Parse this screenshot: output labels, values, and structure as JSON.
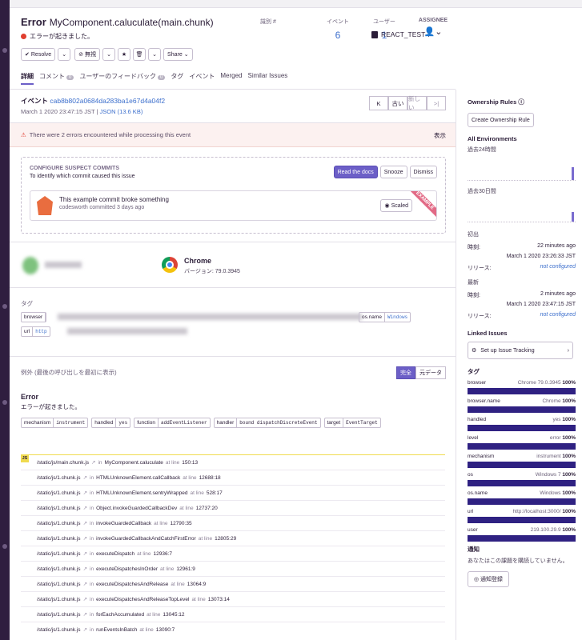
{
  "header": {
    "error_label": "Error",
    "title": "MyComponent.caluculate(main.chunk)",
    "message": "エラーが起きました。",
    "project_label": "識別 #",
    "project_name": "REACT_TEST-7",
    "events_label": "イベント",
    "events_count": "6",
    "users_label": "ユーザー",
    "users_count": "1",
    "assignee_label": "ASSIGNEE",
    "actions": {
      "resolve": "Resolve",
      "ignore": "無視",
      "share": "Share"
    },
    "tabs": [
      {
        "label": "詳細"
      },
      {
        "label": "コメント",
        "badge": "0"
      },
      {
        "label": "ユーザーのフィードバック",
        "badge": "0"
      },
      {
        "label": "タグ"
      },
      {
        "label": "イベント"
      },
      {
        "label": "Merged"
      },
      {
        "label": "Similar Issues"
      }
    ]
  },
  "event": {
    "label": "イベント",
    "id": "cab8b802a0684da283ba1e67d4a04f2",
    "timestamp": "March 1 2020 23:47:15 JST",
    "json_link": "JSON (13.6 KB)",
    "nav_older": "古い",
    "nav_newer": "新しい"
  },
  "alert": {
    "text": "There were 2 errors encountered while processing this event",
    "show": "表示"
  },
  "suspect": {
    "heading": "CONFIGURE SUSPECT COMMITS",
    "subheading": "To identify which commit caused this issue",
    "read_docs": "Read the docs",
    "snooze": "Snooze",
    "dismiss": "Dismiss",
    "commit_title": "This example commit broke something",
    "commit_meta": "codesworth committed 3 days ago",
    "scaled": "Scaled",
    "ribbon": "EXAMPLE"
  },
  "user_agent": {
    "browser": "Chrome",
    "version": "バージョン: 79.0.3945"
  },
  "tags_section": {
    "heading": "タグ",
    "pills": [
      {
        "key": "browser",
        "value": ""
      },
      {
        "key": "os.name",
        "value": "Windows"
      },
      {
        "key": "url",
        "value": "http"
      }
    ]
  },
  "exception": {
    "heading": "例外 (最後の呼び出しを最初に表示)",
    "toggle_full": "完全",
    "toggle_raw": "元データ",
    "type": "Error",
    "message": "エラーが起きました。",
    "mechanism": [
      {
        "key": "mechanism",
        "value": "instrument"
      },
      {
        "key": "handled",
        "value": "yes"
      },
      {
        "key": "function",
        "value": "addEventListener"
      },
      {
        "key": "handler",
        "value": "bound dispatchDiscreteEvent"
      },
      {
        "key": "target",
        "value": "EventTarget"
      }
    ],
    "js_badge": "JS",
    "in_word": "in",
    "at_line_word": "at line",
    "frames": [
      {
        "file": "/static/js/main.chunk.js",
        "fn": "MyComponent.caluculate",
        "line": "150:13"
      },
      {
        "file": "/static/js/1.chunk.js",
        "fn": "HTMLUnknownElement.callCallback",
        "line": "12688:18"
      },
      {
        "file": "/static/js/1.chunk.js",
        "fn": "HTMLUnknownElement.sentryWrapped",
        "line": "528:17"
      },
      {
        "file": "/static/js/1.chunk.js",
        "fn": "Object.invokeGuardedCallbackDev",
        "line": "12737:20"
      },
      {
        "file": "/static/js/1.chunk.js",
        "fn": "invokeGuardedCallback",
        "line": "12790:35"
      },
      {
        "file": "/static/js/1.chunk.js",
        "fn": "invokeGuardedCallbackAndCatchFirstError",
        "line": "12805:29"
      },
      {
        "file": "/static/js/1.chunk.js",
        "fn": "executeDispatch",
        "line": "12936:7"
      },
      {
        "file": "/static/js/1.chunk.js",
        "fn": "executeDispatchesInOrder",
        "line": "12961:9"
      },
      {
        "file": "/static/js/1.chunk.js",
        "fn": "executeDispatchesAndRelease",
        "line": "13064:9"
      },
      {
        "file": "/static/js/1.chunk.js",
        "fn": "executeDispatchesAndReleaseTopLevel",
        "line": "13073:14"
      },
      {
        "file": "/static/js/1.chunk.js",
        "fn": "forEachAccumulated",
        "line": "13045:12"
      },
      {
        "file": "/static/js/1.chunk.js",
        "fn": "runEventsInBatch",
        "line": "13090:7"
      }
    ]
  },
  "sidebar": {
    "ownership_rules": "Ownership Rules",
    "create_rule": "Create Ownership Rule",
    "all_envs": "All Environments",
    "last_24h": "過去24時間",
    "last_30d": "過去30日間",
    "first_seen_label": "初出",
    "last_seen_label": "最新",
    "time_label": "時刻:",
    "release_label": "リリース:",
    "first_seen_rel": "22 minutes ago",
    "first_seen_abs": "March 1 2020 23:26:33 JST",
    "last_seen_rel": "2 minutes ago",
    "last_seen_abs": "March 1 2020 23:47:15 JST",
    "not_configured": "not configured",
    "linked_issues": "Linked Issues",
    "setup_tracking": "Set up Issue Tracking",
    "tags_heading": "タグ",
    "tags": [
      {
        "key": "browser",
        "value": "Chrome 79.0.3945",
        "pct": "100%"
      },
      {
        "key": "browser.name",
        "value": "Chrome",
        "pct": "100%"
      },
      {
        "key": "handled",
        "value": "yes",
        "pct": "100%"
      },
      {
        "key": "level",
        "value": "error",
        "pct": "100%"
      },
      {
        "key": "mechanism",
        "value": "instrument",
        "pct": "100%"
      },
      {
        "key": "os",
        "value": "Windows 7",
        "pct": "100%"
      },
      {
        "key": "os.name",
        "value": "Windows",
        "pct": "100%"
      },
      {
        "key": "url",
        "value": "http://localhost:3000/",
        "pct": "100%"
      },
      {
        "key": "user",
        "value": "219.100.29.9",
        "pct": "100%"
      }
    ],
    "notify_heading": "通知",
    "notify_text": "あなたはこの課題を購読していません。",
    "subscribe": "通知登録"
  }
}
